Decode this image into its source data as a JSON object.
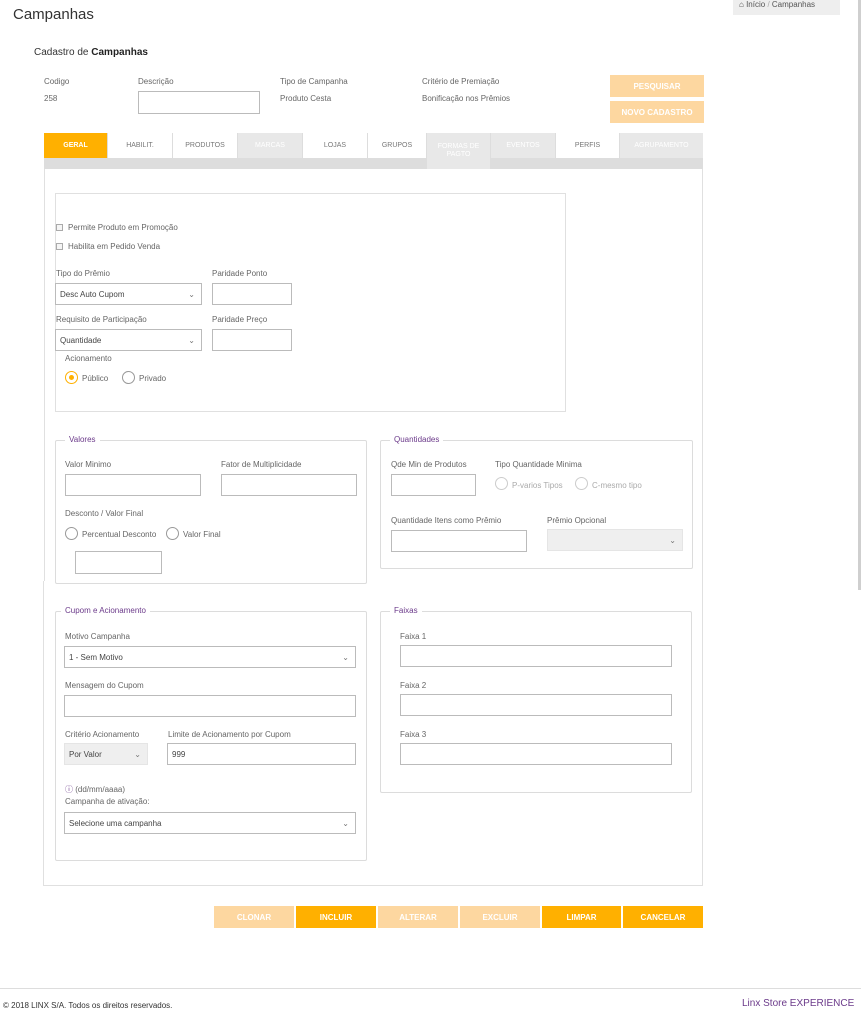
{
  "header": {
    "title": "Campanhas",
    "breadcrumb": {
      "home": "Início",
      "separator": "/",
      "current": "Campanhas"
    },
    "subtitle_prefix": "Cadastro de",
    "subtitle_bold": "Campanhas"
  },
  "info": {
    "codigo_label": "Codigo",
    "codigo_value": "258",
    "descricao_label": "Descrição",
    "descricao_value": "",
    "tipo_label": "Tipo de Campanha",
    "tipo_value": "Produto Cesta",
    "criterio_label": "Critério de Premiação",
    "criterio_value": "Bonificação nos Prêmios"
  },
  "actions": {
    "pesquisar": "PESQUISAR",
    "novo_cadastro": "NOVO CADASTRO"
  },
  "tabs": [
    {
      "label": "GERAL"
    },
    {
      "label": "HABILIT."
    },
    {
      "label": "PRODUTOS"
    },
    {
      "label": "MARCAS"
    },
    {
      "label": "LOJAS"
    },
    {
      "label": "GRUPOS"
    },
    {
      "label": "FORMAS DE PAGTO"
    },
    {
      "label": "EVENTOS"
    },
    {
      "label": "PERFIS"
    },
    {
      "label": "AGRUPAMENTO"
    }
  ],
  "geral": {
    "permite_promocao": "Permite Produto em Promoção",
    "habilita_pedido": "Habilita em Pedido Venda",
    "tipo_premio_label": "Tipo do Prêmio",
    "tipo_premio_value": "Desc Auto Cupom",
    "paridade_ponto_label": "Paridade Ponto",
    "requisito_label": "Requisito de Participação",
    "requisito_value": "Quantidade",
    "paridade_preco_label": "Paridade Preço",
    "acionamento_label": "Acionamento",
    "publico": "Público",
    "privado": "Privado"
  },
  "valores": {
    "legend": "Valores",
    "valor_minimo": "Valor Minimo",
    "fator": "Fator de Multiplicidade",
    "desconto_label": "Desconto / Valor Final",
    "percentual": "Percentual Desconto",
    "valor_final": "Valor Final"
  },
  "quantidades": {
    "legend": "Quantidades",
    "qde_min": "Qde Min de Produtos",
    "tipo_qtd": "Tipo Quantidade Minima",
    "p_varios": "P-varios Tipos",
    "c_mesmo": "C-mesmo tipo",
    "qtd_itens": "Quantidade Itens como Prêmio",
    "premio_opcional": "Prêmio Opcional"
  },
  "cupom": {
    "legend": "Cupom e Acionamento",
    "motivo_label": "Motivo Campanha",
    "motivo_value": "1 - Sem Motivo",
    "mensagem_label": "Mensagem do Cupom",
    "criterio_label": "Critério Acionamento",
    "criterio_value": "Por Valor",
    "limite_label": "Limite de Acionamento por Cupom",
    "limite_value": "999",
    "date_hint": "(dd/mm/aaaa)",
    "ativacao_label": "Campanha de ativação:",
    "ativacao_value": "Selecione uma campanha"
  },
  "faixas": {
    "legend": "Faixas",
    "faixa1": "Faixa 1",
    "faixa2": "Faixa 2",
    "faixa3": "Faixa 3"
  },
  "bottom_buttons": {
    "clonar": "CLONAR",
    "incluir": "INCLUIR",
    "alterar": "ALTERAR",
    "excluir": "EXCLUIR",
    "limpar": "LIMPAR",
    "cancelar": "CANCELAR"
  },
  "footer": {
    "copyright": "© 2018 LINX S/A. Todos os direitos reservados.",
    "brand": "Linx Store EXPERIENCE"
  },
  "colors": {
    "accent": "#ffb000",
    "accent_light": "#fdd7a0",
    "legend": "#6b3a8a"
  },
  "icons": {
    "home": "home-icon",
    "info": "info-icon",
    "chevron": "chevron-down-icon"
  }
}
